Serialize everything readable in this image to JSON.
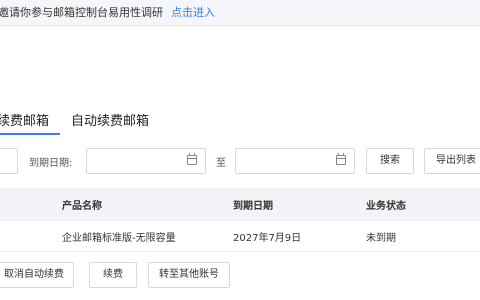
{
  "notice": {
    "text": "邀请你参与邮箱控制台易用性调研",
    "link": "点击进入"
  },
  "tabs": [
    {
      "label": "续费邮箱"
    },
    {
      "label": "自动续费邮箱"
    }
  ],
  "filter": {
    "expire_label": "到期日期:",
    "to_label": "至",
    "search_label": "搜索",
    "export_label": "导出列表"
  },
  "table": {
    "headers": {
      "product": "产品名称",
      "expire": "到期日期",
      "status": "业务状态"
    },
    "rows": [
      {
        "product": "企业邮箱标准版-无限容量",
        "expire": "2027年7月9日",
        "status": "未到期"
      }
    ]
  },
  "actions": {
    "cancel_auto": "取消自动续费",
    "renew": "续费",
    "transfer": "转至其他账号"
  },
  "colors": {
    "accent": "#3b7ee8",
    "header_bg": "#f2f4f7",
    "notice_bg": "#f4f6f9"
  }
}
